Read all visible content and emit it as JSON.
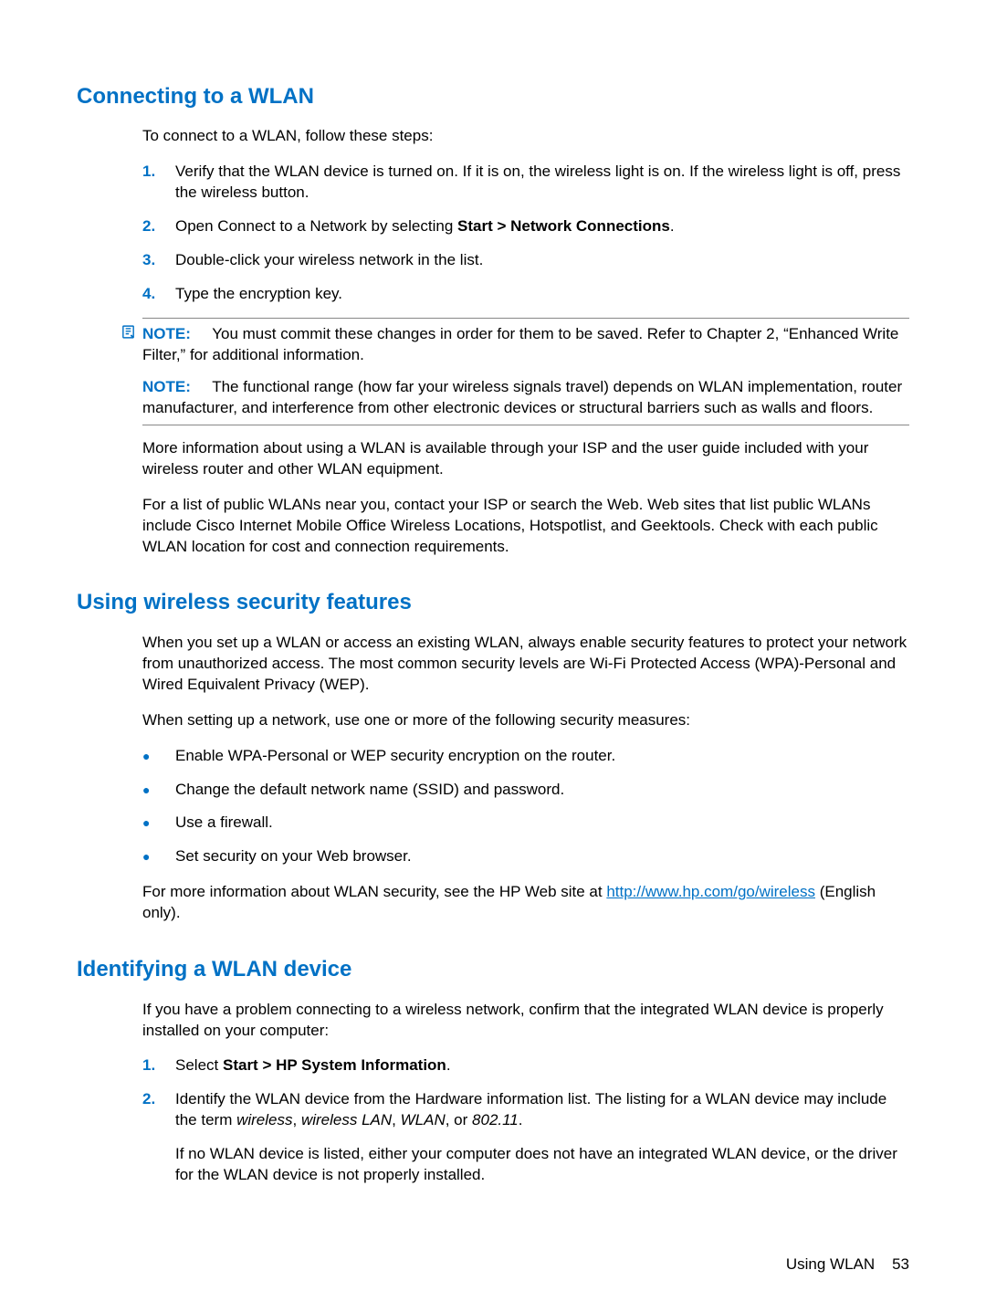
{
  "section1": {
    "title": "Connecting to a WLAN",
    "intro": "To connect to a WLAN, follow these steps:",
    "steps": [
      "Verify that the WLAN device is turned on. If it is on, the wireless light is on. If the wireless light is off, press the wireless button.",
      "Open Connect to a Network by selecting ",
      "Double-click your wireless network in the list.",
      "Type the encryption key."
    ],
    "step2_bold": "Start > Network Connections",
    "step2_suffix": ".",
    "note1_label": "NOTE:",
    "note1_text": "You must commit these changes in order for them to be saved. Refer to Chapter 2, “Enhanced Write Filter,” for additional information.",
    "note2_label": "NOTE:",
    "note2_text": "The functional range (how far your wireless signals travel) depends on WLAN implementation, router manufacturer, and interference from other electronic devices or structural barriers such as walls and floors.",
    "para1": "More information about using a WLAN is available through your ISP and the user guide included with your wireless router and other WLAN equipment.",
    "para2": "For a list of public WLANs near you, contact your ISP or search the Web. Web sites that list public WLANs include Cisco Internet Mobile Office Wireless Locations, Hotspotlist, and Geektools. Check with each public WLAN location for cost and connection requirements."
  },
  "section2": {
    "title": "Using wireless security features",
    "para1": "When you set up a WLAN or access an existing WLAN, always enable security features to protect your network from unauthorized access. The most common security levels are Wi-Fi Protected Access (WPA)-Personal and Wired Equivalent Privacy (WEP).",
    "para2": "When setting up a network, use one or more of the following security measures:",
    "bullets": [
      "Enable WPA-Personal or WEP security encryption on the router.",
      "Change the default network name (SSID) and password.",
      "Use a firewall.",
      "Set security on your Web browser."
    ],
    "para3_prefix": "For more information about WLAN security, see the HP Web site at ",
    "para3_link": "http://www.hp.com/go/wireless",
    "para3_suffix": " (English only)."
  },
  "section3": {
    "title": "Identifying a WLAN device",
    "para1": "If you have a problem connecting to a wireless network, confirm that the integrated WLAN device is properly installed on your computer:",
    "step1_prefix": "Select ",
    "step1_bold": "Start > HP System Information",
    "step1_suffix": ".",
    "step2_p1_prefix": "Identify the WLAN device from the Hardware information list. The listing for a WLAN device may include the term ",
    "step2_p1_i1": "wireless",
    "step2_p1_s1": ", ",
    "step2_p1_i2": "wireless LAN",
    "step2_p1_s2": ", ",
    "step2_p1_i3": "WLAN",
    "step2_p1_s3": ", or ",
    "step2_p1_i4": "802.11",
    "step2_p1_suffix": ".",
    "step2_p2": "If no WLAN device is listed, either your computer does not have an integrated WLAN device, or the driver for the WLAN device is not properly installed."
  },
  "footer": {
    "text": "Using WLAN",
    "page": "53"
  },
  "labels": {
    "n1": "1.",
    "n2": "2.",
    "n3": "3.",
    "n4": "4.",
    "bullet": "●"
  }
}
